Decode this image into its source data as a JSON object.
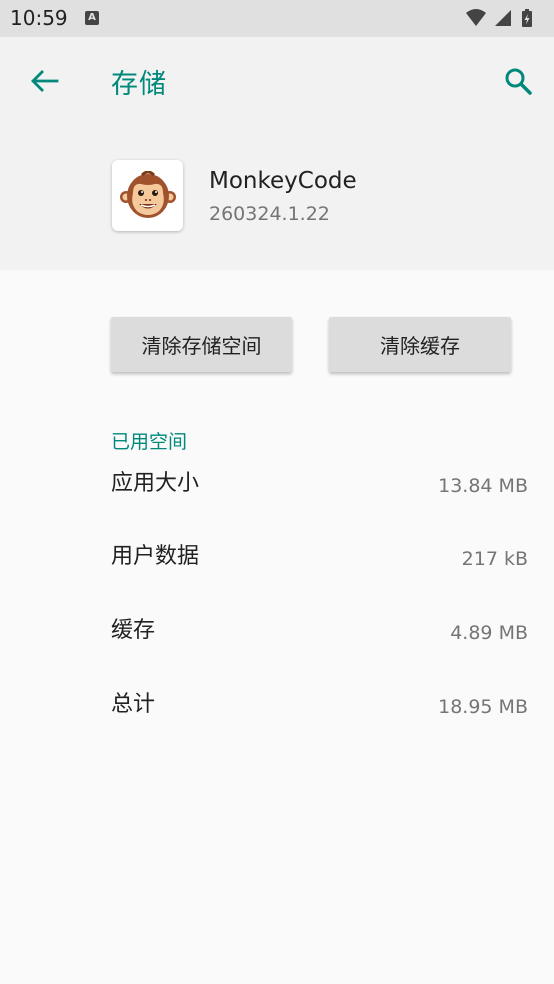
{
  "status_bar": {
    "time": "10:59",
    "notification_icon_letter": "A",
    "icons": [
      "wifi-icon",
      "signal-icon",
      "battery-icon"
    ]
  },
  "header": {
    "title": "存储",
    "title_color": "#00897b"
  },
  "app": {
    "name": "MonkeyCode",
    "version": "260324.1.22",
    "icon": "monkey-face-icon"
  },
  "actions": {
    "clear_storage": "清除存储空间",
    "clear_cache": "清除缓存"
  },
  "storage": {
    "section_title": "已用空间",
    "rows": [
      {
        "label": "应用大小",
        "value": "13.84 MB"
      },
      {
        "label": "用户数据",
        "value": "217 kB"
      },
      {
        "label": "缓存",
        "value": "4.89 MB"
      },
      {
        "label": "总计",
        "value": "18.95 MB"
      }
    ]
  }
}
